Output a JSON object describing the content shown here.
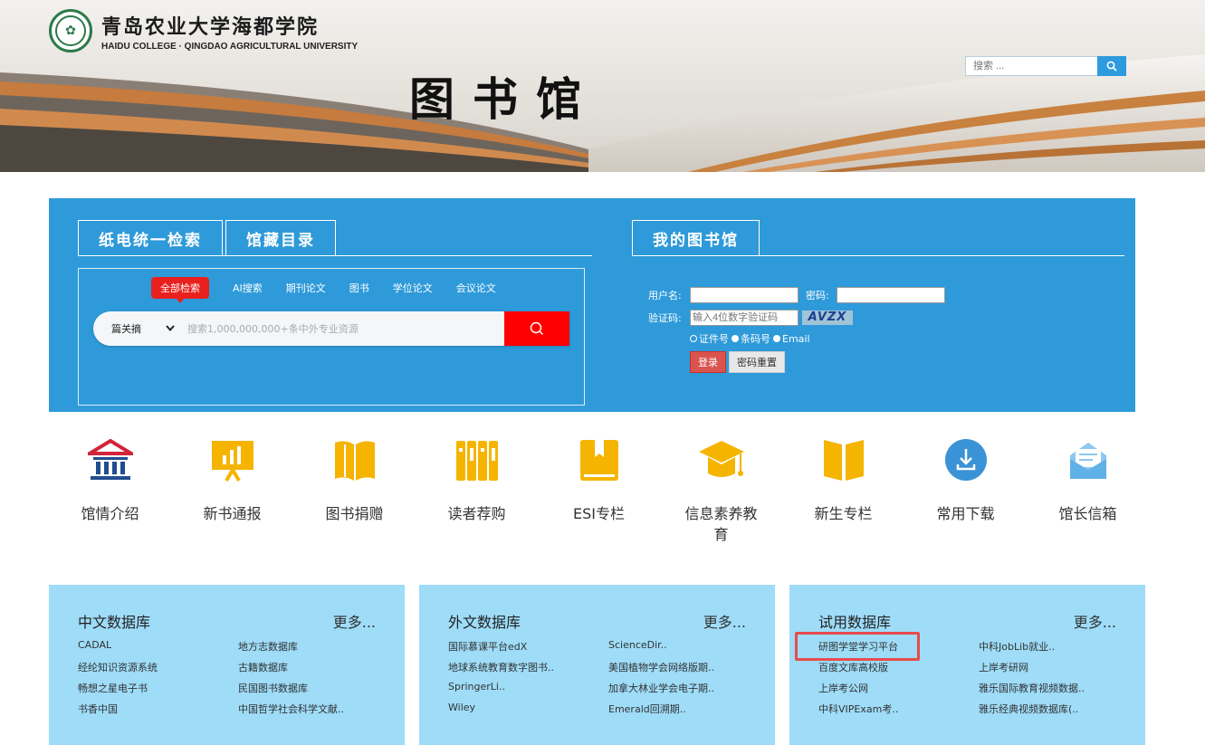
{
  "header": {
    "school_cn": "青岛农业大学海都学院",
    "school_en": "HAIDU COLLEGE · QINGDAO AGRICULTURAL UNIVERSITY",
    "title": "图书馆",
    "search_placeholder": "搜索 ..."
  },
  "search_panel": {
    "tabs": [
      {
        "label": "纸电统一检索"
      },
      {
        "label": "馆藏目录"
      }
    ],
    "categories": [
      {
        "label": "全部检索"
      },
      {
        "label": "AI搜索"
      },
      {
        "label": "期刊论文"
      },
      {
        "label": "图书"
      },
      {
        "label": "学位论文"
      },
      {
        "label": "会议论文"
      }
    ],
    "select_value": "篇关摘",
    "placeholder": "搜索1,000,000,000+条中外专业资源"
  },
  "my_library": {
    "tab_label": "我的图书馆",
    "username_label": "用户名:",
    "password_label": "密码:",
    "captcha_label": "验证码:",
    "captcha_placeholder": "输入4位数字验证码",
    "captcha_text": "AVZX",
    "radio_options": [
      "证件号",
      "条码号",
      "Email"
    ],
    "login_label": "登录",
    "reset_label": "密码重置"
  },
  "quick_links": [
    {
      "label": "馆情介绍",
      "icon": "library-building-icon"
    },
    {
      "label": "新书通报",
      "icon": "presentation-chart-icon"
    },
    {
      "label": "图书捐赠",
      "icon": "open-book-icon"
    },
    {
      "label": "读者荐购",
      "icon": "bookshelf-icon"
    },
    {
      "label": "ESI专栏",
      "icon": "bookmark-book-icon"
    },
    {
      "label": "信息素养教育",
      "icon": "graduation-cap-icon"
    },
    {
      "label": "新生专栏",
      "icon": "book-icon"
    },
    {
      "label": "常用下载",
      "icon": "download-icon"
    },
    {
      "label": "馆长信箱",
      "icon": "mail-icon"
    }
  ],
  "databases": [
    {
      "title": "中文数据库",
      "more": "更多...",
      "items": [
        "CADAL",
        "地方志数据库",
        "经纶知识资源系统",
        "古籍数据库",
        "畅想之星电子书",
        "民国图书数据库",
        "书香中国",
        "中国哲学社会科学文献.."
      ]
    },
    {
      "title": "外文数据库",
      "more": "更多...",
      "items": [
        "国际慕课平台edX",
        "ScienceDir..",
        "地球系统教育数字图书..",
        "美国植物学会网络版期..",
        "SpringerLi..",
        "加拿大林业学会电子期..",
        "Wiley",
        "Emerald回溯期.."
      ]
    },
    {
      "title": "试用数据库",
      "more": "更多...",
      "items": [
        "研图学堂学习平台",
        "中科JobLib就业..",
        "百度文库高校版",
        "上岸考研网",
        "上岸考公网",
        "雅乐国际教育视频数据..",
        "中科VIPExam考..",
        "雅乐经典视频数据库(.."
      ]
    }
  ]
}
